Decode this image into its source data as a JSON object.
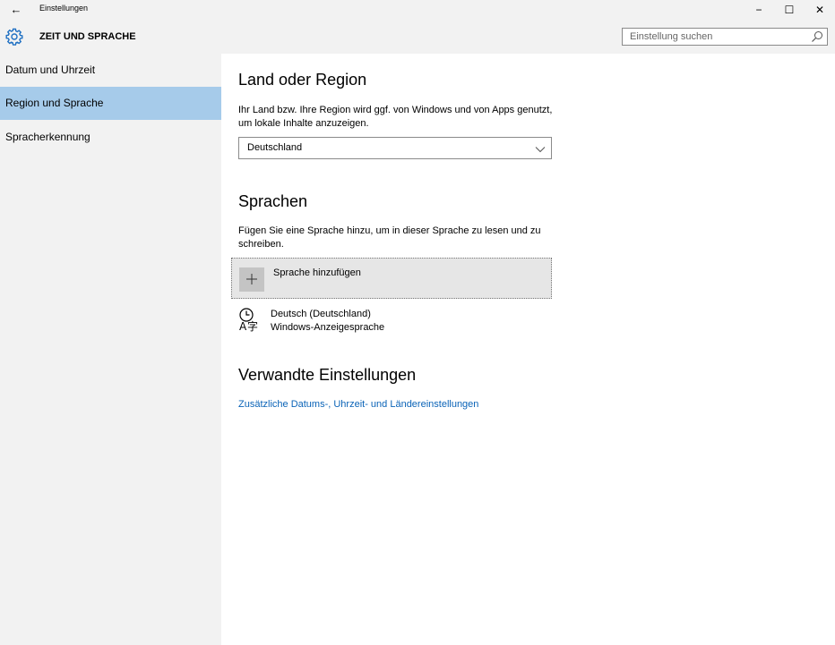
{
  "window": {
    "title": "Einstellungen",
    "back_glyph": "←",
    "minimize_glyph": "−",
    "maximize_glyph": "☐",
    "close_glyph": "✕"
  },
  "header": {
    "title": "ZEIT UND SPRACHE",
    "icon": "gear-icon",
    "search_placeholder": "Einstellung suchen"
  },
  "sidebar": {
    "items": [
      {
        "label": "Datum und Uhrzeit",
        "selected": false
      },
      {
        "label": "Region und Sprache",
        "selected": true
      },
      {
        "label": "Spracherkennung",
        "selected": false
      }
    ]
  },
  "region": {
    "title": "Land oder Region",
    "description": "Ihr Land bzw. Ihre Region wird ggf. von Windows und von Apps genutzt, um lokale Inhalte anzuzeigen.",
    "selected_country": "Deutschland"
  },
  "languages": {
    "title": "Sprachen",
    "description": "Fügen Sie eine Sprache hinzu, um in dieser Sprache zu lesen und zu schreiben.",
    "add_label": "Sprache hinzufügen",
    "installed": [
      {
        "name": "Deutsch (Deutschland)",
        "subtitle": "Windows-Anzeigesprache"
      }
    ]
  },
  "related": {
    "title": "Verwandte Einstellungen",
    "link": "Zusätzliche Datums-, Uhrzeit- und Ländereinstellungen"
  },
  "colors": {
    "selected_nav": "#a6cbea",
    "link": "#0a63b7",
    "accent_icon": "#1e6fc2"
  }
}
